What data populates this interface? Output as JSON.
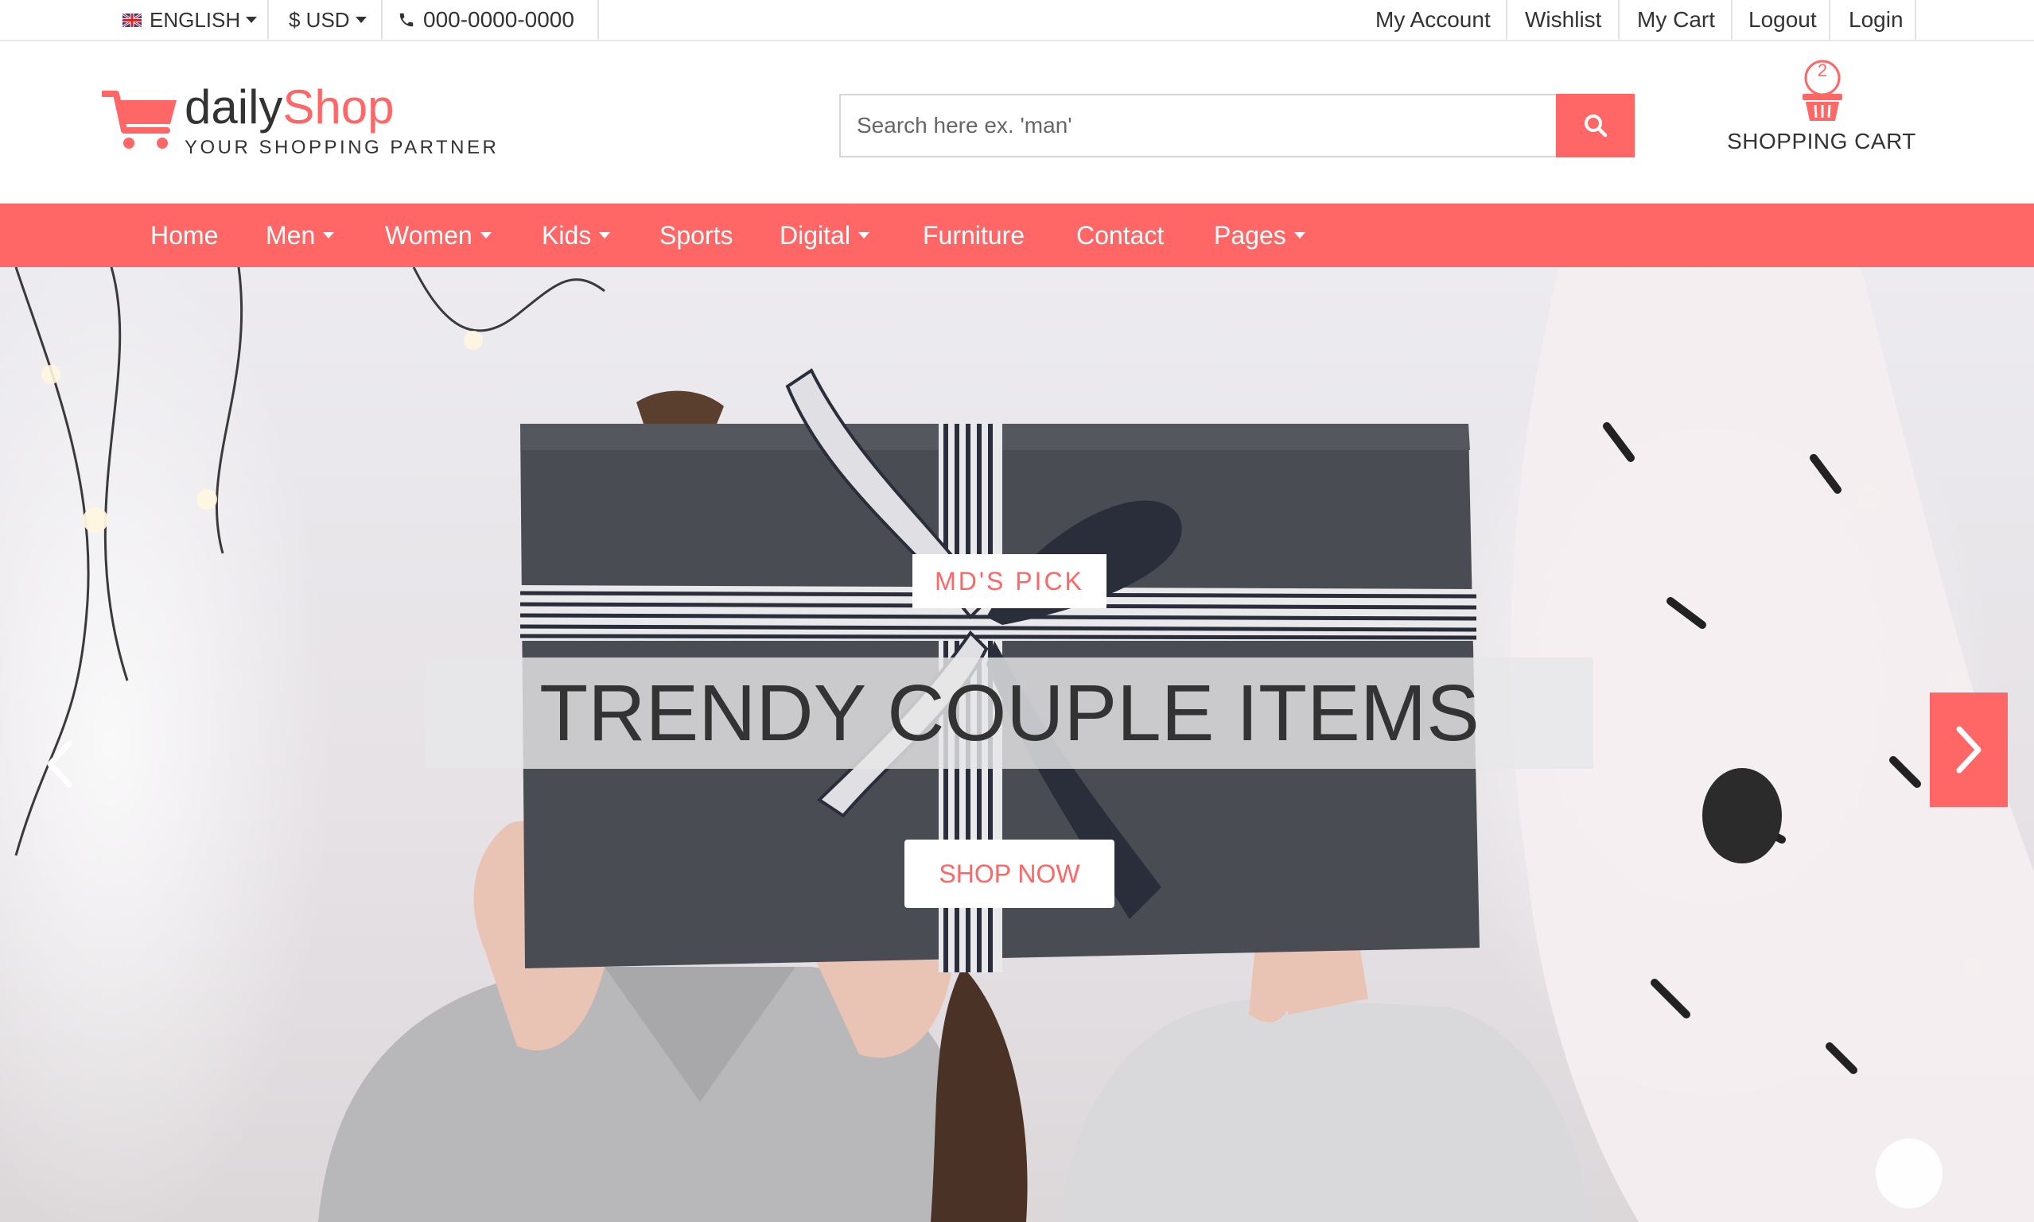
{
  "topbar": {
    "language": "ENGLISH",
    "currency": "$ USD",
    "phone": "000-0000-0000",
    "links": [
      "My Account",
      "Wishlist",
      "My Cart",
      "Logout",
      "Login"
    ]
  },
  "header": {
    "logo_part1": "daily",
    "logo_part2": "Shop",
    "tagline": "YOUR SHOPPING PARTNER",
    "search_placeholder": "Search here ex. 'man'",
    "cart_count": "2",
    "cart_label": "SHOPPING CART"
  },
  "nav": {
    "items": [
      {
        "label": "Home",
        "dropdown": false
      },
      {
        "label": "Men",
        "dropdown": true
      },
      {
        "label": "Women",
        "dropdown": true
      },
      {
        "label": "Kids",
        "dropdown": true
      },
      {
        "label": "Sports",
        "dropdown": false
      },
      {
        "label": "Digital",
        "dropdown": true
      },
      {
        "label": "Furniture",
        "dropdown": false
      },
      {
        "label": "Contact",
        "dropdown": false
      },
      {
        "label": "Pages",
        "dropdown": true
      }
    ]
  },
  "hero": {
    "badge": "MD'S PICK",
    "headline": "TRENDY COUPLE ITEMS",
    "cta": "SHOP NOW"
  },
  "icons": {
    "flag": "uk-flag-icon",
    "phone": "phone-icon",
    "search": "search-icon",
    "cart": "basket-icon",
    "prev": "chevron-left-icon",
    "next": "chevron-right-icon"
  },
  "colors": {
    "accent": "#ff6666",
    "text": "#333333"
  }
}
